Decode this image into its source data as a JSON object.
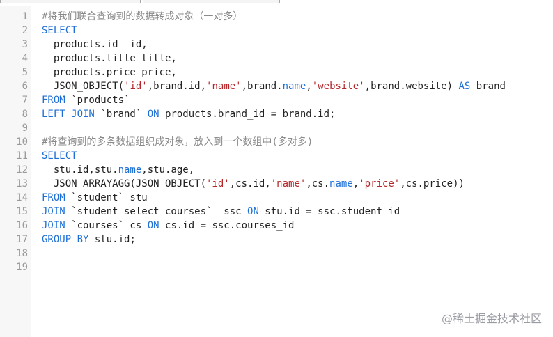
{
  "tabs": [
    {
      "label": ""
    },
    {
      "label": ""
    }
  ],
  "editor": {
    "lines": [
      {
        "number": "1",
        "tokens": [
          {
            "t": "#将我们联合查询到的数据转成对象（一对多）",
            "k": "cm"
          }
        ]
      },
      {
        "number": "2",
        "tokens": [
          {
            "t": "SELECT",
            "k": "kw"
          }
        ]
      },
      {
        "number": "3",
        "tokens": [
          {
            "t": "  products.id  id,",
            "k": "plain"
          }
        ]
      },
      {
        "number": "4",
        "tokens": [
          {
            "t": "  products.title title,",
            "k": "plain"
          }
        ]
      },
      {
        "number": "5",
        "tokens": [
          {
            "t": "  products.price price,",
            "k": "plain"
          }
        ]
      },
      {
        "number": "6",
        "tokens": [
          {
            "t": "  JSON_OBJECT(",
            "k": "plain"
          },
          {
            "t": "'id'",
            "k": "str"
          },
          {
            "t": ",brand.id,",
            "k": "plain"
          },
          {
            "t": "'name'",
            "k": "str"
          },
          {
            "t": ",brand.",
            "k": "plain"
          },
          {
            "t": "name",
            "k": "kw"
          },
          {
            "t": ",",
            "k": "plain"
          },
          {
            "t": "'website'",
            "k": "str"
          },
          {
            "t": ",brand.website) ",
            "k": "plain"
          },
          {
            "t": "AS",
            "k": "kw"
          },
          {
            "t": " brand",
            "k": "plain"
          }
        ]
      },
      {
        "number": "7",
        "tokens": [
          {
            "t": "FROM",
            "k": "kw"
          },
          {
            "t": " `products`",
            "k": "plain"
          }
        ]
      },
      {
        "number": "8",
        "tokens": [
          {
            "t": "LEFT JOIN",
            "k": "kw"
          },
          {
            "t": " `brand` ",
            "k": "plain"
          },
          {
            "t": "ON",
            "k": "kw"
          },
          {
            "t": " products.brand_id = brand.id;",
            "k": "plain"
          }
        ]
      },
      {
        "number": "9",
        "tokens": []
      },
      {
        "number": "10",
        "tokens": [
          {
            "t": "#将查询到的多条数据组织成对象，放入到一个数组中(多对多)",
            "k": "cm"
          }
        ]
      },
      {
        "number": "11",
        "tokens": [
          {
            "t": "SELECT",
            "k": "kw"
          }
        ]
      },
      {
        "number": "12",
        "tokens": [
          {
            "t": "  stu.id,stu.",
            "k": "plain"
          },
          {
            "t": "name",
            "k": "kw"
          },
          {
            "t": ",stu.age,",
            "k": "plain"
          }
        ]
      },
      {
        "number": "13",
        "tokens": [
          {
            "t": "  JSON_ARRAYAGG(JSON_OBJECT(",
            "k": "plain"
          },
          {
            "t": "'id'",
            "k": "str"
          },
          {
            "t": ",cs.id,",
            "k": "plain"
          },
          {
            "t": "'name'",
            "k": "str"
          },
          {
            "t": ",cs.",
            "k": "plain"
          },
          {
            "t": "name",
            "k": "kw"
          },
          {
            "t": ",",
            "k": "plain"
          },
          {
            "t": "'price'",
            "k": "str"
          },
          {
            "t": ",cs.price))",
            "k": "plain"
          }
        ]
      },
      {
        "number": "14",
        "tokens": [
          {
            "t": "FROM",
            "k": "kw"
          },
          {
            "t": " `student` stu",
            "k": "plain"
          }
        ]
      },
      {
        "number": "15",
        "tokens": [
          {
            "t": "JOIN",
            "k": "kw"
          },
          {
            "t": " `student_select_courses`  ssc ",
            "k": "plain"
          },
          {
            "t": "ON",
            "k": "kw"
          },
          {
            "t": " stu.id = ssc.student_id",
            "k": "plain"
          }
        ]
      },
      {
        "number": "16",
        "tokens": [
          {
            "t": "JOIN",
            "k": "kw"
          },
          {
            "t": " `courses` cs ",
            "k": "plain"
          },
          {
            "t": "ON",
            "k": "kw"
          },
          {
            "t": " cs.id = ssc.courses_id",
            "k": "plain"
          }
        ]
      },
      {
        "number": "17",
        "tokens": [
          {
            "t": "GROUP BY",
            "k": "kw"
          },
          {
            "t": " stu.id;",
            "k": "plain"
          }
        ]
      },
      {
        "number": "18",
        "tokens": []
      },
      {
        "number": "19",
        "tokens": []
      }
    ]
  },
  "watermark": {
    "text": "@稀土掘金技术社区"
  },
  "colors": {
    "keyword": "#1d6fd6",
    "string": "#b4262a",
    "comment": "#8a8a8a",
    "text": "#222222",
    "gutter_bg": "#f7f7f7",
    "line_number": "#9a9a9a"
  }
}
